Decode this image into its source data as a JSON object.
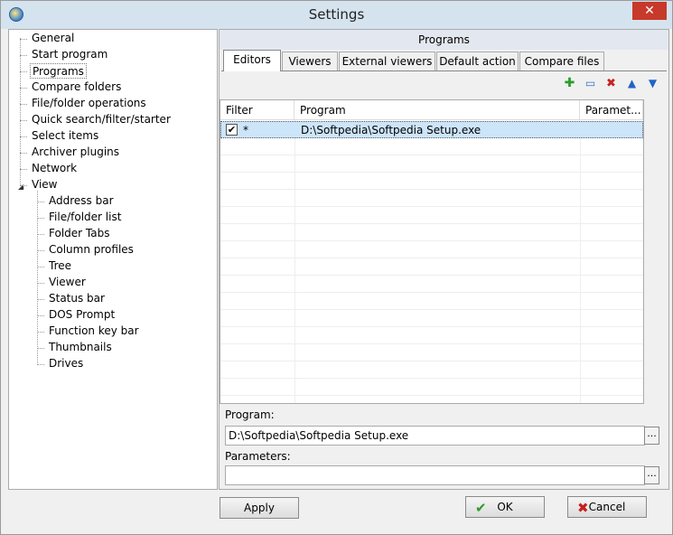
{
  "window": {
    "title": "Settings"
  },
  "tree": {
    "items": [
      {
        "label": "General",
        "level": 0
      },
      {
        "label": "Start program",
        "level": 0
      },
      {
        "label": "Programs",
        "level": 0,
        "selected": true
      },
      {
        "label": "Compare folders",
        "level": 0
      },
      {
        "label": "File/folder operations",
        "level": 0
      },
      {
        "label": "Quick search/filter/starter",
        "level": 0
      },
      {
        "label": "Select items",
        "level": 0
      },
      {
        "label": "Archiver plugins",
        "level": 0
      },
      {
        "label": "Network",
        "level": 0
      },
      {
        "label": "View",
        "level": 0,
        "expanded": true
      },
      {
        "label": "Address bar",
        "level": 1
      },
      {
        "label": "File/folder list",
        "level": 1
      },
      {
        "label": "Folder Tabs",
        "level": 1
      },
      {
        "label": "Column profiles",
        "level": 1
      },
      {
        "label": "Tree",
        "level": 1
      },
      {
        "label": "Viewer",
        "level": 1
      },
      {
        "label": "Status bar",
        "level": 1
      },
      {
        "label": "DOS Prompt",
        "level": 1
      },
      {
        "label": "Function key bar",
        "level": 1
      },
      {
        "label": "Thumbnails",
        "level": 1
      },
      {
        "label": "Drives",
        "level": 1
      }
    ]
  },
  "panel": {
    "header": "Programs",
    "tabs": [
      "Editors",
      "Viewers",
      "External viewers",
      "Default action",
      "Compare files"
    ],
    "active_tab": "Editors",
    "grid": {
      "columns": [
        "Filter",
        "Program",
        "Paramet..."
      ],
      "rows": [
        {
          "checked": true,
          "filter": "*",
          "program": "D:\\Softpedia\\Softpedia Setup.exe",
          "parameters": ""
        }
      ]
    },
    "program_label": "Program:",
    "program_value": "D:\\Softpedia\\Softpedia Setup.exe",
    "parameters_label": "Parameters:",
    "parameters_value": "",
    "browse_label": "..."
  },
  "buttons": {
    "apply": "Apply",
    "ok": "OK",
    "cancel": "Cancel",
    "close": "✕"
  },
  "icons": {
    "add": "add-icon",
    "edit": "edit-icon",
    "delete": "delete-icon",
    "up": "arrow-up-icon",
    "down": "arrow-down-icon"
  }
}
